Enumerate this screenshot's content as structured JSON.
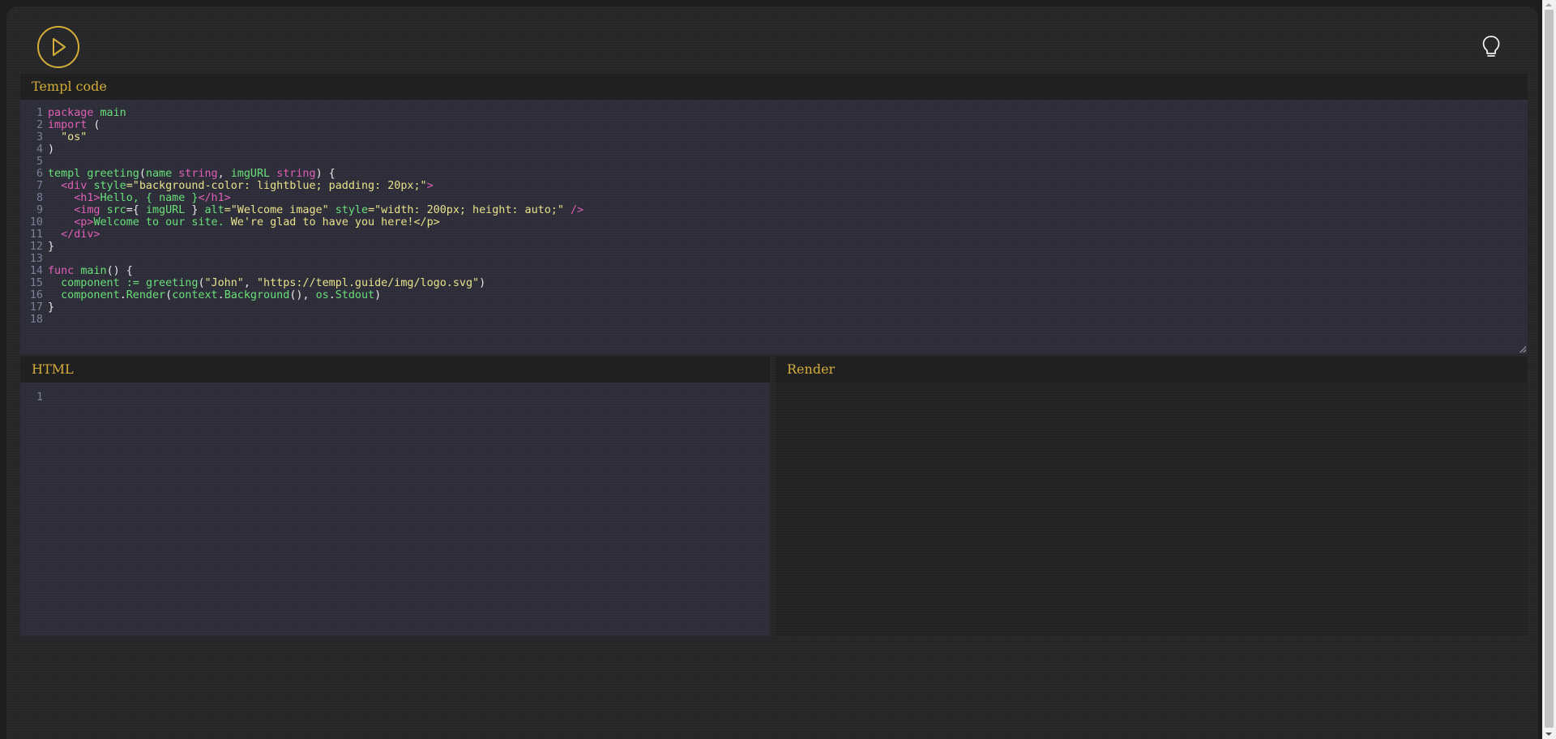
{
  "toolbar": {
    "run_icon": "play-icon",
    "theme_icon": "lightbulb-icon",
    "accent": "#d4ad38"
  },
  "templ_panel": {
    "title": "Templ code",
    "lines": [
      [
        {
          "t": "package ",
          "c": "kw"
        },
        {
          "t": "main",
          "c": "fn"
        }
      ],
      [
        {
          "t": "import",
          "c": "kw"
        },
        {
          "t": " (",
          "c": "pl"
        }
      ],
      [
        {
          "t": "  \"os\"",
          "c": "str"
        }
      ],
      [
        {
          "t": ")",
          "c": "pl"
        }
      ],
      [],
      [
        {
          "t": "templ ",
          "c": "fn"
        },
        {
          "t": "greeting",
          "c": "fn"
        },
        {
          "t": "(",
          "c": "pl"
        },
        {
          "t": "name ",
          "c": "fn"
        },
        {
          "t": "string",
          "c": "kw"
        },
        {
          "t": ", ",
          "c": "pl"
        },
        {
          "t": "imgURL ",
          "c": "fn"
        },
        {
          "t": "string",
          "c": "kw"
        },
        {
          "t": ") {",
          "c": "pl"
        }
      ],
      [
        {
          "t": "  ",
          "c": "pl"
        },
        {
          "t": "<div ",
          "c": "tag"
        },
        {
          "t": "style",
          "c": "attr"
        },
        {
          "t": "=\"background-color: lightblue; padding: 20px;\"",
          "c": "str"
        },
        {
          "t": ">",
          "c": "tag"
        }
      ],
      [
        {
          "t": "    ",
          "c": "pl"
        },
        {
          "t": "<h1>",
          "c": "tag"
        },
        {
          "t": "Hello, { ",
          "c": "text"
        },
        {
          "t": "name",
          "c": "fn"
        },
        {
          "t": " }",
          "c": "text"
        },
        {
          "t": "</h1>",
          "c": "tag"
        }
      ],
      [
        {
          "t": "    ",
          "c": "pl"
        },
        {
          "t": "<img ",
          "c": "tag"
        },
        {
          "t": "src",
          "c": "attr"
        },
        {
          "t": "={ ",
          "c": "pl"
        },
        {
          "t": "imgURL",
          "c": "fn"
        },
        {
          "t": " } ",
          "c": "pl"
        },
        {
          "t": "alt",
          "c": "attr"
        },
        {
          "t": "=\"Welcome image\" ",
          "c": "str"
        },
        {
          "t": "style",
          "c": "attr"
        },
        {
          "t": "=\"width: 200px; height: auto;\"",
          "c": "str"
        },
        {
          "t": " />",
          "c": "tag"
        }
      ],
      [
        {
          "t": "    ",
          "c": "pl"
        },
        {
          "t": "<p>",
          "c": "tag"
        },
        {
          "t": "Welcome to our site. ",
          "c": "text"
        },
        {
          "t": "We're glad to have you here!</p>",
          "c": "str"
        }
      ],
      [
        {
          "t": "  ",
          "c": "pl"
        },
        {
          "t": "</div>",
          "c": "tag"
        }
      ],
      [
        {
          "t": "}",
          "c": "pl"
        }
      ],
      [],
      [
        {
          "t": "func ",
          "c": "kw"
        },
        {
          "t": "main",
          "c": "fn"
        },
        {
          "t": "() {",
          "c": "pl"
        }
      ],
      [
        {
          "t": "  component := ",
          "c": "fn"
        },
        {
          "t": "greeting",
          "c": "fn"
        },
        {
          "t": "(",
          "c": "pl"
        },
        {
          "t": "\"John\"",
          "c": "str"
        },
        {
          "t": ", ",
          "c": "pl"
        },
        {
          "t": "\"https://templ.guide/img/logo.svg\"",
          "c": "str"
        },
        {
          "t": ")",
          "c": "pl"
        }
      ],
      [
        {
          "t": "  component",
          "c": "fn"
        },
        {
          "t": ".",
          "c": "pl"
        },
        {
          "t": "Render",
          "c": "fn"
        },
        {
          "t": "(",
          "c": "pl"
        },
        {
          "t": "context",
          "c": "fn"
        },
        {
          "t": ".",
          "c": "pl"
        },
        {
          "t": "Background",
          "c": "fn"
        },
        {
          "t": "(), ",
          "c": "pl"
        },
        {
          "t": "os",
          "c": "fn"
        },
        {
          "t": ".",
          "c": "pl"
        },
        {
          "t": "Stdout",
          "c": "fn"
        },
        {
          "t": ")",
          "c": "pl"
        }
      ],
      [
        {
          "t": "}",
          "c": "pl"
        }
      ],
      []
    ]
  },
  "html_panel": {
    "title": "HTML",
    "lines": [
      []
    ]
  },
  "render_panel": {
    "title": "Render"
  }
}
